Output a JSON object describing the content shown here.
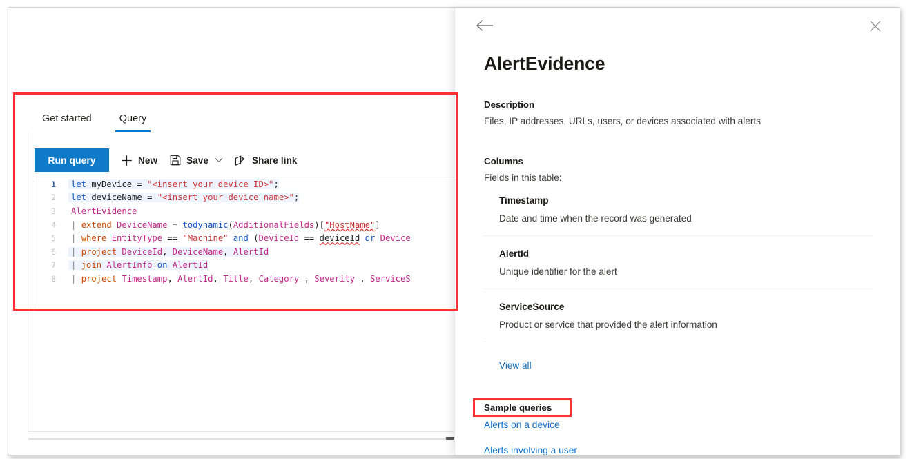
{
  "left_pane": {
    "tabs": [
      {
        "label": "Get started",
        "active": false
      },
      {
        "label": "Query",
        "active": true
      }
    ],
    "commandbar": {
      "run_query_label": "Run query",
      "new_label": "New",
      "new_icon": "plus-icon",
      "save_label": "Save",
      "save_icon": "save-disk-icon",
      "save_chevron_icon": "chevron-down-icon",
      "share_label": "Share link",
      "share_icon": "share-icon"
    },
    "editor": {
      "line_numbers": [
        "1",
        "2",
        "3",
        "4",
        "5",
        "6",
        "7",
        "8"
      ],
      "lines": [
        "let myDevice = \"<insert your device ID>\";",
        "let deviceName = \"<insert your device name>\";",
        "AlertEvidence",
        "| extend DeviceName = todynamic(AdditionalFields)[\"HostName\"]",
        "| where EntityType == \"Machine\" and (DeviceId == deviceId or Device",
        "| project DeviceId, DeviceName, AlertId",
        "| join AlertInfo on AlertId",
        "| project Timestamp, AlertId, Title, Category , Severity , ServiceS"
      ]
    }
  },
  "flyout": {
    "back_icon": "back-arrow-icon",
    "close_icon": "close-icon",
    "title": "AlertEvidence",
    "description_head": "Description",
    "description_text": "Files, IP addresses, URLs, users, or devices associated with alerts",
    "columns_head": "Columns",
    "columns_subtext": "Fields in this table:",
    "columns": [
      {
        "name": "Timestamp",
        "desc": "Date and time when the record was generated"
      },
      {
        "name": "AlertId",
        "desc": "Unique identifier for the alert"
      },
      {
        "name": "ServiceSource",
        "desc": "Product or service that provided the alert information"
      }
    ],
    "view_all_label": "View all",
    "samples_head": "Sample queries",
    "samples": [
      {
        "label": "Alerts on a device",
        "highlighted": true
      },
      {
        "label": "Alerts involving a user",
        "highlighted": false
      }
    ]
  },
  "annotations": {
    "color": "#fc3131",
    "boxes": [
      {
        "name": "query-editor-highlight"
      },
      {
        "name": "sample-query-highlight"
      }
    ]
  }
}
